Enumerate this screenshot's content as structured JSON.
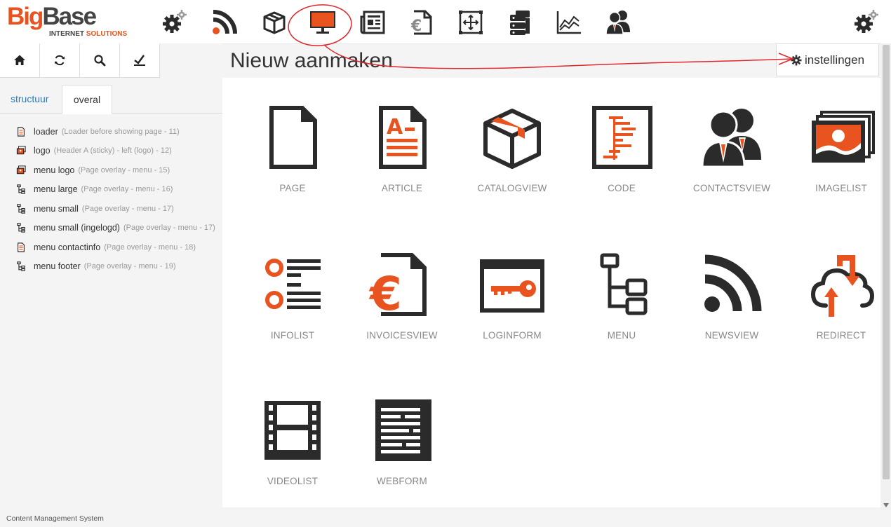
{
  "logo": {
    "big": "Big",
    "base": "Base",
    "internet": "INTERNET",
    "solutions": "SOLUTIONS"
  },
  "top_icons": [
    "gear-icon",
    "rss-icon",
    "box-icon",
    "monitor-icon",
    "newspaper-icon",
    "euro-document-icon",
    "resize-icon",
    "server-icon",
    "line-chart-icon",
    "users-icon"
  ],
  "toolbar": [
    "home-icon",
    "refresh-icon",
    "search-icon",
    "check-icon"
  ],
  "tabs": {
    "structuur": "structuur",
    "overal": "overal",
    "active": "overal"
  },
  "tree": [
    {
      "name": "loader",
      "desc": "(Loader before showing page - 11)",
      "icon": "article"
    },
    {
      "name": "logo",
      "desc": "(Header A (sticky) - left (logo) - 12)",
      "icon": "imagelist"
    },
    {
      "name": "menu logo",
      "desc": "(Page overlay - menu - 15)",
      "icon": "imagelist"
    },
    {
      "name": "menu large",
      "desc": "(Page overlay - menu - 16)",
      "icon": "menu"
    },
    {
      "name": "menu small",
      "desc": "(Page overlay - menu - 17)",
      "icon": "menu"
    },
    {
      "name": "menu small (ingelogd)",
      "desc": "(Page overlay - menu - 17)",
      "icon": "menu"
    },
    {
      "name": "menu contactinfo",
      "desc": "(Page overlay - menu - 18)",
      "icon": "article"
    },
    {
      "name": "menu footer",
      "desc": "(Page overlay - menu - 19)",
      "icon": "menu"
    }
  ],
  "page_title": "Nieuw aanmaken",
  "settings_label": "instellingen",
  "tiles": [
    {
      "label": "PAGE",
      "icon": "page-icon"
    },
    {
      "label": "ARTICLE",
      "icon": "article-icon"
    },
    {
      "label": "CATALOGVIEW",
      "icon": "catalog-box-icon"
    },
    {
      "label": "CODE",
      "icon": "code-icon"
    },
    {
      "label": "CONTACTSVIEW",
      "icon": "contacts-icon"
    },
    {
      "label": "IMAGELIST",
      "icon": "imagelist-icon"
    },
    {
      "label": "INFOLIST",
      "icon": "infolist-icon"
    },
    {
      "label": "INVOICESVIEW",
      "icon": "invoice-icon"
    },
    {
      "label": "LOGINFORM",
      "icon": "key-icon"
    },
    {
      "label": "MENU",
      "icon": "menu-tree-icon"
    },
    {
      "label": "NEWSVIEW",
      "icon": "rss-icon"
    },
    {
      "label": "REDIRECT",
      "icon": "cloud-redirect-icon"
    },
    {
      "label": "VIDEOLIST",
      "icon": "film-icon"
    },
    {
      "label": "WEBFORM",
      "icon": "webform-icon"
    }
  ],
  "footer": "Content Management System",
  "colors": {
    "accent": "#e8531f",
    "dark": "#2b2b2b",
    "link": "#2a7ab8",
    "annotation": "#e0262b"
  }
}
